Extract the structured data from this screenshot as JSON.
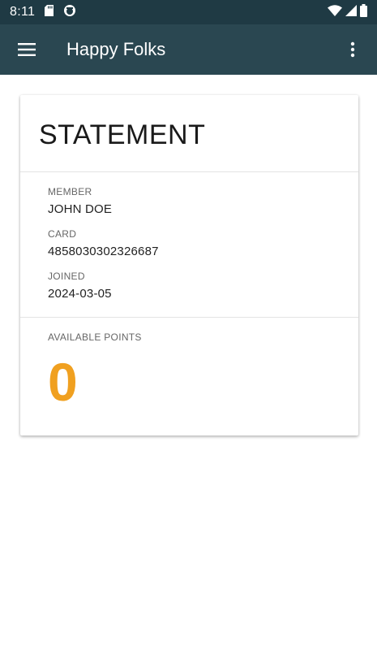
{
  "status_bar": {
    "time": "8:11",
    "icons": [
      "sd-card-icon",
      "sync-icon",
      "wifi-icon",
      "cell-signal-icon",
      "battery-icon"
    ]
  },
  "app_bar": {
    "title": "Happy Folks",
    "menu_icon": "hamburger-menu-icon",
    "overflow_icon": "more-vert-icon"
  },
  "statement": {
    "title": "STATEMENT",
    "member": {
      "label": "MEMBER",
      "value": "JOHN DOE"
    },
    "card": {
      "label": "CARD",
      "value": "4858030302326687"
    },
    "joined": {
      "label": "JOINED",
      "value": "2024-03-05"
    },
    "points": {
      "label": "AVAILABLE POINTS",
      "value": "0"
    }
  },
  "colors": {
    "status_bar": "#1f3a44",
    "app_bar": "#2a4751",
    "points_accent": "#f0a020"
  }
}
